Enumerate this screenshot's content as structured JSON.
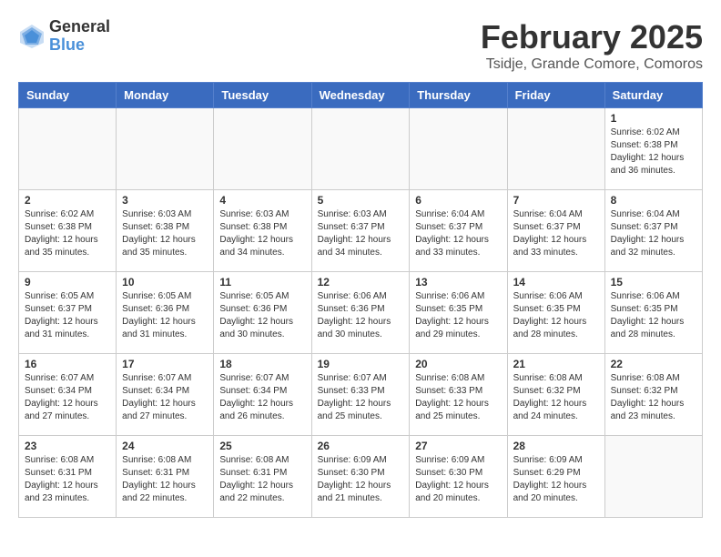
{
  "logo": {
    "general": "General",
    "blue": "Blue"
  },
  "title": "February 2025",
  "subtitle": "Tsidje, Grande Comore, Comoros",
  "days_of_week": [
    "Sunday",
    "Monday",
    "Tuesday",
    "Wednesday",
    "Thursday",
    "Friday",
    "Saturday"
  ],
  "weeks": [
    [
      {
        "day": "",
        "info": ""
      },
      {
        "day": "",
        "info": ""
      },
      {
        "day": "",
        "info": ""
      },
      {
        "day": "",
        "info": ""
      },
      {
        "day": "",
        "info": ""
      },
      {
        "day": "",
        "info": ""
      },
      {
        "day": "1",
        "info": "Sunrise: 6:02 AM\nSunset: 6:38 PM\nDaylight: 12 hours\nand 36 minutes."
      }
    ],
    [
      {
        "day": "2",
        "info": "Sunrise: 6:02 AM\nSunset: 6:38 PM\nDaylight: 12 hours\nand 35 minutes."
      },
      {
        "day": "3",
        "info": "Sunrise: 6:03 AM\nSunset: 6:38 PM\nDaylight: 12 hours\nand 35 minutes."
      },
      {
        "day": "4",
        "info": "Sunrise: 6:03 AM\nSunset: 6:38 PM\nDaylight: 12 hours\nand 34 minutes."
      },
      {
        "day": "5",
        "info": "Sunrise: 6:03 AM\nSunset: 6:37 PM\nDaylight: 12 hours\nand 34 minutes."
      },
      {
        "day": "6",
        "info": "Sunrise: 6:04 AM\nSunset: 6:37 PM\nDaylight: 12 hours\nand 33 minutes."
      },
      {
        "day": "7",
        "info": "Sunrise: 6:04 AM\nSunset: 6:37 PM\nDaylight: 12 hours\nand 33 minutes."
      },
      {
        "day": "8",
        "info": "Sunrise: 6:04 AM\nSunset: 6:37 PM\nDaylight: 12 hours\nand 32 minutes."
      }
    ],
    [
      {
        "day": "9",
        "info": "Sunrise: 6:05 AM\nSunset: 6:37 PM\nDaylight: 12 hours\nand 31 minutes."
      },
      {
        "day": "10",
        "info": "Sunrise: 6:05 AM\nSunset: 6:36 PM\nDaylight: 12 hours\nand 31 minutes."
      },
      {
        "day": "11",
        "info": "Sunrise: 6:05 AM\nSunset: 6:36 PM\nDaylight: 12 hours\nand 30 minutes."
      },
      {
        "day": "12",
        "info": "Sunrise: 6:06 AM\nSunset: 6:36 PM\nDaylight: 12 hours\nand 30 minutes."
      },
      {
        "day": "13",
        "info": "Sunrise: 6:06 AM\nSunset: 6:35 PM\nDaylight: 12 hours\nand 29 minutes."
      },
      {
        "day": "14",
        "info": "Sunrise: 6:06 AM\nSunset: 6:35 PM\nDaylight: 12 hours\nand 28 minutes."
      },
      {
        "day": "15",
        "info": "Sunrise: 6:06 AM\nSunset: 6:35 PM\nDaylight: 12 hours\nand 28 minutes."
      }
    ],
    [
      {
        "day": "16",
        "info": "Sunrise: 6:07 AM\nSunset: 6:34 PM\nDaylight: 12 hours\nand 27 minutes."
      },
      {
        "day": "17",
        "info": "Sunrise: 6:07 AM\nSunset: 6:34 PM\nDaylight: 12 hours\nand 27 minutes."
      },
      {
        "day": "18",
        "info": "Sunrise: 6:07 AM\nSunset: 6:34 PM\nDaylight: 12 hours\nand 26 minutes."
      },
      {
        "day": "19",
        "info": "Sunrise: 6:07 AM\nSunset: 6:33 PM\nDaylight: 12 hours\nand 25 minutes."
      },
      {
        "day": "20",
        "info": "Sunrise: 6:08 AM\nSunset: 6:33 PM\nDaylight: 12 hours\nand 25 minutes."
      },
      {
        "day": "21",
        "info": "Sunrise: 6:08 AM\nSunset: 6:32 PM\nDaylight: 12 hours\nand 24 minutes."
      },
      {
        "day": "22",
        "info": "Sunrise: 6:08 AM\nSunset: 6:32 PM\nDaylight: 12 hours\nand 23 minutes."
      }
    ],
    [
      {
        "day": "23",
        "info": "Sunrise: 6:08 AM\nSunset: 6:31 PM\nDaylight: 12 hours\nand 23 minutes."
      },
      {
        "day": "24",
        "info": "Sunrise: 6:08 AM\nSunset: 6:31 PM\nDaylight: 12 hours\nand 22 minutes."
      },
      {
        "day": "25",
        "info": "Sunrise: 6:08 AM\nSunset: 6:31 PM\nDaylight: 12 hours\nand 22 minutes."
      },
      {
        "day": "26",
        "info": "Sunrise: 6:09 AM\nSunset: 6:30 PM\nDaylight: 12 hours\nand 21 minutes."
      },
      {
        "day": "27",
        "info": "Sunrise: 6:09 AM\nSunset: 6:30 PM\nDaylight: 12 hours\nand 20 minutes."
      },
      {
        "day": "28",
        "info": "Sunrise: 6:09 AM\nSunset: 6:29 PM\nDaylight: 12 hours\nand 20 minutes."
      },
      {
        "day": "",
        "info": ""
      }
    ]
  ]
}
